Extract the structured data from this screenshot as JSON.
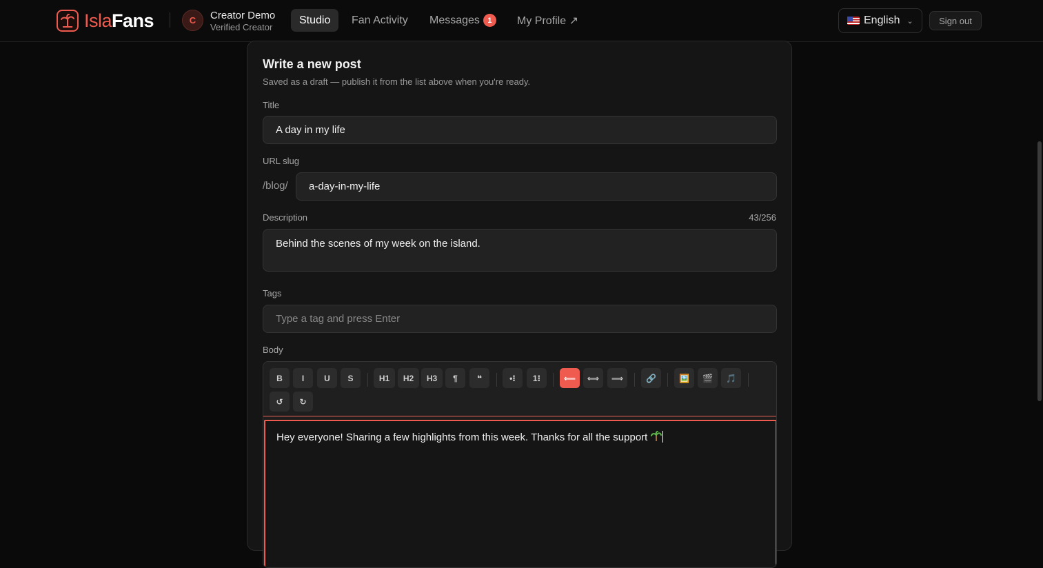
{
  "nav": {
    "brand_a": "Isla",
    "brand_b": "Fans",
    "avatar_initial": "C",
    "user_name": "Creator Demo",
    "user_role": "Verified Creator",
    "links": [
      {
        "label": "Studio",
        "active": true
      },
      {
        "label": "Fan Activity"
      },
      {
        "label": "Messages",
        "badge": "1"
      },
      {
        "label": "My Profile ↗"
      }
    ],
    "language": "English",
    "sign_out": "Sign out"
  },
  "form": {
    "title": "Write a new post",
    "subtitle": "Saved as a draft — publish it from the list above when you're ready.",
    "title_label": "Title",
    "title_value": "A day in my life",
    "slug_label": "URL slug",
    "slug_prefix": "/blog/",
    "slug_value": "a-day-in-my-life",
    "description_label": "Description",
    "description_counter": "43/256",
    "description_value": "Behind the scenes of my week on the island.",
    "tags_label": "Tags",
    "tags_placeholder": "Type a tag and press Enter",
    "body_label": "Body",
    "body_text": "Hey everyone! Sharing a few highlights from this week. Thanks for all the support"
  },
  "toolbar": {
    "bold": "B",
    "italic": "I",
    "underline": "U",
    "strike": "S",
    "h1": "H1",
    "h2": "H2",
    "h3": "H3",
    "paragraph": "¶",
    "quote": "❝",
    "bullet": "•⁝",
    "ordered": "1⁝",
    "align_left": "⟸",
    "align_center": "⟺",
    "align_right": "⟹",
    "link": "🔗",
    "image": "🖼️",
    "video": "🎬",
    "audio": "🎵",
    "undo": "↺",
    "redo": "↻"
  },
  "colors": {
    "accent": "#ef5b4f",
    "background": "#0a0a0a",
    "card": "#151515"
  }
}
